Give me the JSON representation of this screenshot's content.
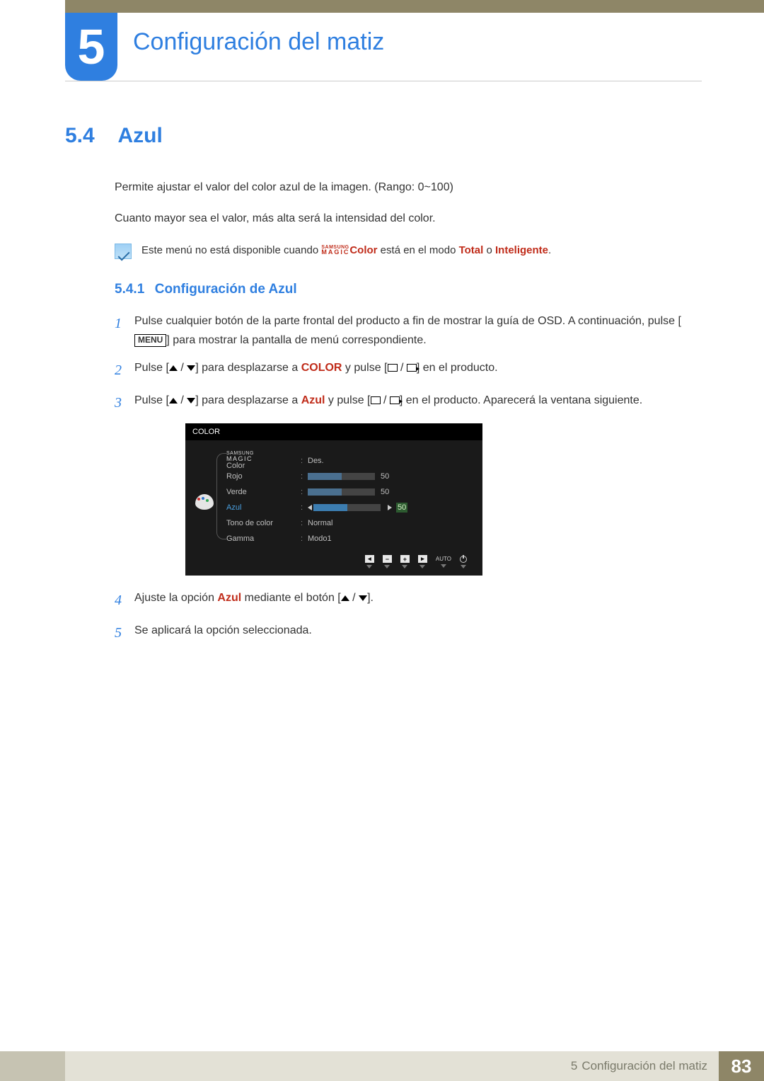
{
  "chapter": {
    "number": "5",
    "title": "Configuración del matiz"
  },
  "section": {
    "number": "5.4",
    "title": "Azul"
  },
  "intro_p1": "Permite ajustar el valor del color azul de la imagen. (Rango: 0~100)",
  "intro_p2": "Cuanto mayor sea el valor, más alta será la intensidad del color.",
  "note": {
    "pre": "Este menú no está disponible cuando ",
    "magic_top": "SAMSUNG",
    "magic_bot": "MAGIC",
    "magic_suffix": "Color",
    "mid": " está en el modo ",
    "mode1": "Total",
    "or": " o ",
    "mode2": "Inteligente",
    "end": "."
  },
  "subsection": {
    "number": "5.4.1",
    "title": "Configuración de Azul"
  },
  "steps": {
    "s1": {
      "pre": "Pulse cualquier botón de la parte frontal del producto a fin de mostrar la guía de OSD. A continuación, pulse [",
      "menu": "MENU",
      "post": "] para mostrar la pantalla de menú correspondiente."
    },
    "s2": {
      "pre": "Pulse [",
      "mid": "] para desplazarse a ",
      "kw": "COLOR",
      "mid2": " y pulse [",
      "post": "] en el producto."
    },
    "s3": {
      "pre": "Pulse [",
      "mid": "] para desplazarse a ",
      "kw": "Azul",
      "mid2": " y pulse [",
      "post": "] en el producto. Aparecerá la ventana siguiente."
    },
    "s4": {
      "pre": "Ajuste la opción ",
      "kw": "Azul",
      "mid": " mediante el botón [",
      "post": "]."
    },
    "s5": "Se aplicará la opción seleccionada."
  },
  "osd": {
    "header": "COLOR",
    "magic_top": "SAMSUNG",
    "magic_bot": "MAGIC",
    "magic_suffix": "Color",
    "magic_val": "Des.",
    "rows": {
      "rojo": {
        "label": "Rojo",
        "value": 50
      },
      "verde": {
        "label": "Verde",
        "value": 50
      },
      "azul": {
        "label": "Azul",
        "value": 50
      },
      "tono": {
        "label": "Tono de color",
        "value": "Normal"
      },
      "gamma": {
        "label": "Gamma",
        "value": "Modo1"
      }
    },
    "footer_auto": "AUTO"
  },
  "footer": {
    "chapter_num": "5",
    "chapter_title": "Configuración del matiz",
    "page": "83"
  }
}
